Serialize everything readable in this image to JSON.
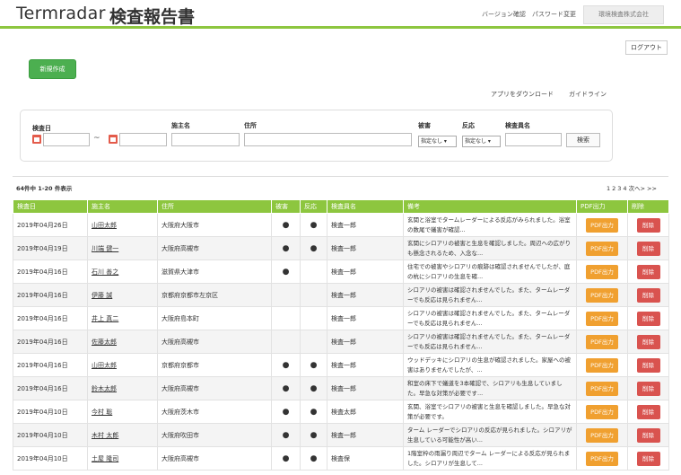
{
  "header": {
    "brand": "Termradar",
    "title": "検査報告書",
    "version_link": "バージョン確認",
    "password_link": "パスワード変更",
    "company": "環境検査株式会社"
  },
  "logout_label": "ログアウト",
  "new_button_label": "新規作成",
  "links": {
    "app_download": "アプリをダウンロード",
    "guideline": "ガイドライン"
  },
  "search": {
    "date_label": "検査日",
    "tilde": "~",
    "owner_label": "施主名",
    "address_label": "住所",
    "damage_label": "被害",
    "damage_value": "指定なし ▾",
    "reaction_label": "反応",
    "reaction_value": "指定なし ▾",
    "inspector_label": "検査員名",
    "search_button": "検索"
  },
  "result_count": "64件中 1-20 件表示",
  "pager": [
    "1",
    "2",
    "3",
    "4",
    "次へ>",
    ">>"
  ],
  "table": {
    "headers": [
      "検査日",
      "施主名",
      "住所",
      "被害",
      "反応",
      "検査員名",
      "備考",
      "PDF出力",
      "削除"
    ],
    "pdf_label": "PDF出力",
    "delete_label": "削除",
    "rows": [
      {
        "date": "2019年04月26日",
        "name": "山田太郎",
        "address": "大阪府大阪市",
        "damage": "●",
        "reaction": "●",
        "inspector": "検査一郎",
        "note": "玄関と浴室でタームレーダーによる反応がみられました。浴室の数尾で蟻害が確認..."
      },
      {
        "date": "2019年04月19日",
        "name": "川端 健一",
        "address": "大阪府高槻市",
        "damage": "●",
        "reaction": "●",
        "inspector": "検査一郎",
        "note": "玄関にシロアリの被害と生息を確認しました。周辺への広がりも懸念されるため、入念な..."
      },
      {
        "date": "2019年04月16日",
        "name": "石川 善之",
        "address": "滋賀県大津市",
        "damage": "●",
        "reaction": "",
        "inspector": "検査一郎",
        "note": "住宅での被害やシロアリの痕跡は確認されませんでしたが、庭の杭にシロアリの生息を確..."
      },
      {
        "date": "2019年04月16日",
        "name": "伊藤 誠",
        "address": "京都府京都市左京区",
        "damage": "",
        "reaction": "",
        "inspector": "検査一郎",
        "note": "シロアリの被害は確認されませんでした。また、タームレーダーでも反応は見られません..."
      },
      {
        "date": "2019年04月16日",
        "name": "井上 真二",
        "address": "大阪府島本町",
        "damage": "",
        "reaction": "",
        "inspector": "検査一郎",
        "note": "シロアリの被害は確認されませんでした。また、タームレーダーでも反応は見られません..."
      },
      {
        "date": "2019年04月16日",
        "name": "佐藤太郎",
        "address": "大阪府高槻市",
        "damage": "",
        "reaction": "",
        "inspector": "検査一郎",
        "note": "シロアリの被害は確認されませんでした。また、タームレーダーでも反応は見られません..."
      },
      {
        "date": "2019年04月16日",
        "name": "山田太郎",
        "address": "京都府京都市",
        "damage": "●",
        "reaction": "●",
        "inspector": "検査一郎",
        "note": "ウッドデッキにシロアリの生息が確認されました。家屋への被害はありませんでしたが、..."
      },
      {
        "date": "2019年04月16日",
        "name": "鈴木太郎",
        "address": "大阪府高槻市",
        "damage": "●",
        "reaction": "●",
        "inspector": "検査一郎",
        "note": "和室の床下で蟻道を3本確認で、シロアリも生息していました。早急な対策が必要です..."
      },
      {
        "date": "2019年04月10日",
        "name": "今村 聡",
        "address": "大阪府茨木市",
        "damage": "●",
        "reaction": "●",
        "inspector": "検査太郎",
        "note": "玄関、浴室でシロアリの被害と生息を確認しました。早急な対策が必要です。"
      },
      {
        "date": "2019年04月10日",
        "name": "木村 太郎",
        "address": "大阪府吹田市",
        "damage": "●",
        "reaction": "●",
        "inspector": "検査一郎",
        "note": "ターム レーダーでシロアリの反応が見られました。シロアリが生息している可能性が高い..."
      },
      {
        "date": "2019年04月10日",
        "name": "土屋 隆司",
        "address": "大阪府高槻市",
        "damage": "●",
        "reaction": "●",
        "inspector": "検査保",
        "note": "1階室枠の雨漏り周辺でターム レーダーによる反応が見られました。シロアリが生息して..."
      }
    ]
  }
}
